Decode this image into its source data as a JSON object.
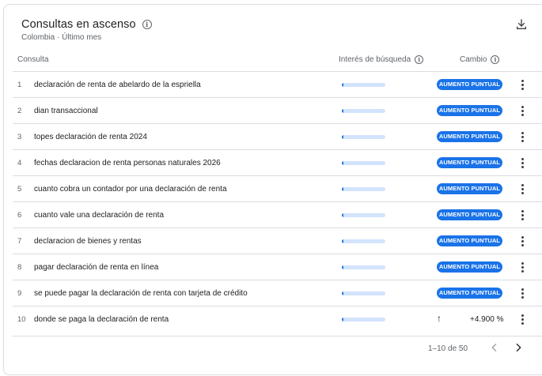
{
  "card": {
    "title": "Consultas en ascenso",
    "subtitle": "Colombia · Último mes",
    "info_icon": "info-icon",
    "download_icon": "download-icon"
  },
  "table": {
    "columns": {
      "query": "Consulta",
      "interest": "Interés de búsqueda",
      "change": "Cambio"
    },
    "rows": [
      {
        "rank": "1",
        "query": "declaración de renta de abelardo de la espriella",
        "interest": 0.03,
        "change": "AUMENTO PUNTUAL",
        "is_breakout": true
      },
      {
        "rank": "2",
        "query": "dian transaccional",
        "interest": 0.03,
        "change": "AUMENTO PUNTUAL",
        "is_breakout": true
      },
      {
        "rank": "3",
        "query": "topes declaración de renta 2024",
        "interest": 0.03,
        "change": "AUMENTO PUNTUAL",
        "is_breakout": true
      },
      {
        "rank": "4",
        "query": "fechas declaracion de renta personas naturales 2026",
        "interest": 0.03,
        "change": "AUMENTO PUNTUAL",
        "is_breakout": true
      },
      {
        "rank": "5",
        "query": "cuanto cobra un contador por una declaración de renta",
        "interest": 0.03,
        "change": "AUMENTO PUNTUAL",
        "is_breakout": true
      },
      {
        "rank": "6",
        "query": "cuanto vale una declaración de renta",
        "interest": 0.03,
        "change": "AUMENTO PUNTUAL",
        "is_breakout": true
      },
      {
        "rank": "7",
        "query": "declaracion de bienes y rentas",
        "interest": 0.03,
        "change": "AUMENTO PUNTUAL",
        "is_breakout": true
      },
      {
        "rank": "8",
        "query": "pagar declaración de renta en línea",
        "interest": 0.03,
        "change": "AUMENTO PUNTUAL",
        "is_breakout": true
      },
      {
        "rank": "9",
        "query": "se puede pagar la declaración de renta con tarjeta de crédito",
        "interest": 0.03,
        "change": "AUMENTO PUNTUAL",
        "is_breakout": true
      },
      {
        "rank": "10",
        "query": "donde se paga la declaración de renta",
        "interest": 0.03,
        "change": "+4.900 %",
        "is_breakout": false
      }
    ]
  },
  "pagination": {
    "label": "1–10 de 50",
    "prev_icon": "chevron-left-icon",
    "next_icon": "chevron-right-icon"
  },
  "colors": {
    "accent": "#1a73e8",
    "bar_track": "#d2e3fc",
    "divider": "#dadce0",
    "muted_text": "#5f6368"
  }
}
